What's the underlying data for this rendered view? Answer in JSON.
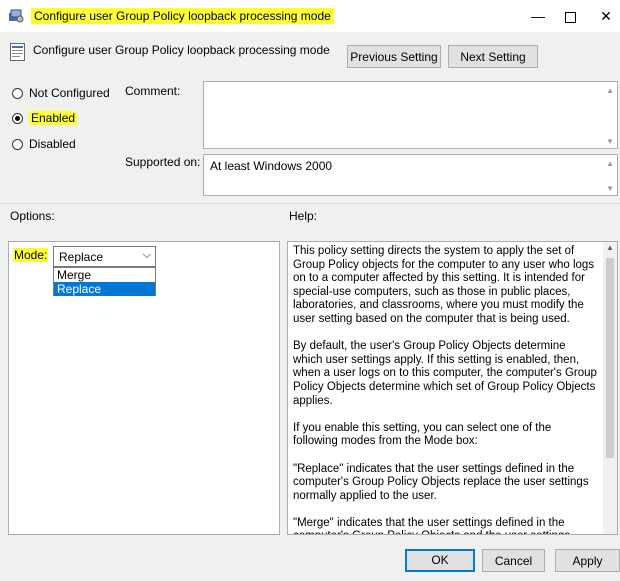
{
  "window": {
    "title": "Configure user Group Policy loopback processing mode",
    "minimize": "—",
    "close": "✕"
  },
  "header": {
    "setting_name": "Configure user Group Policy loopback processing mode",
    "previous_label": "Previous Setting",
    "next_label": "Next Setting"
  },
  "state": {
    "options": [
      {
        "label": "Not Configured",
        "selected": false
      },
      {
        "label": "Enabled",
        "selected": true
      },
      {
        "label": "Disabled",
        "selected": false
      }
    ]
  },
  "comment": {
    "label": "Comment:",
    "value": ""
  },
  "supported": {
    "label": "Supported on:",
    "value": "At least Windows 2000"
  },
  "options_pane": {
    "heading": "Options:",
    "mode_label": "Mode:",
    "mode_value": "Replace",
    "mode_choices": [
      "Merge",
      "Replace"
    ]
  },
  "help_pane": {
    "heading": "Help:",
    "paragraphs": [
      "This policy setting directs the system to apply the set of Group Policy objects for the computer to any user who logs on to a computer affected by this setting. It is intended for special-use computers, such as those in public places, laboratories, and classrooms, where you must modify the user setting based on the computer that is being used.",
      "By default, the user's Group Policy Objects determine which user settings apply. If this setting is enabled, then, when a user logs on to this computer, the computer's Group Policy Objects determine which set of Group Policy Objects applies.",
      "If you enable this setting, you can select one of the following modes from the Mode box:",
      "\"Replace\" indicates that the user settings defined in the computer's Group Policy Objects replace the user settings normally applied to the user.",
      "\"Merge\" indicates that the user settings defined in the computer's Group Policy Objects and the user settings normally"
    ]
  },
  "footer": {
    "ok": "OK",
    "cancel": "Cancel",
    "apply": "Apply"
  },
  "colors": {
    "highlight": "#ffff33",
    "accent": "#0078d7"
  }
}
